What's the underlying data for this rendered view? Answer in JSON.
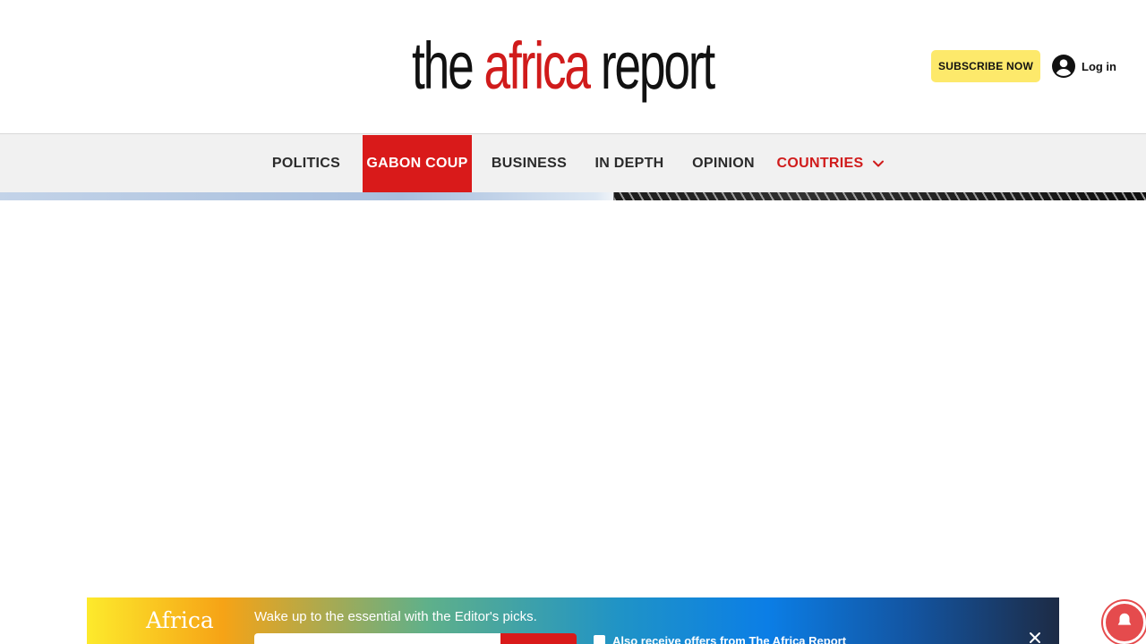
{
  "header": {
    "logo": {
      "word1": "the",
      "word2": "africa",
      "word3": "report"
    },
    "subscribe_label": "SUBSCRIBE NOW",
    "login_label": "Log in"
  },
  "nav": {
    "items": [
      {
        "label": "POLITICS"
      },
      {
        "label": "GABON COUP",
        "active": true
      },
      {
        "label": "BUSINESS"
      },
      {
        "label": "IN DEPTH"
      },
      {
        "label": "OPINION"
      },
      {
        "label": "COUNTRIES",
        "dropdown": true
      }
    ]
  },
  "newsletter": {
    "brand": "Africa",
    "tagline": "Wake up to the essential with the Editor's picks.",
    "checkbox_label": "Also receive offers from The Africa Report"
  },
  "colors": {
    "brand_red": "#d01b1b",
    "subscribe_yellow": "#fde96b",
    "nav_background": "#f1f1f1",
    "notification_red": "#e54b4d"
  },
  "icons": {
    "login": "account-circle-icon",
    "countries_dropdown": "chevron-down-icon",
    "newsletter_close": "close-icon",
    "notifications": "bell-icon"
  }
}
